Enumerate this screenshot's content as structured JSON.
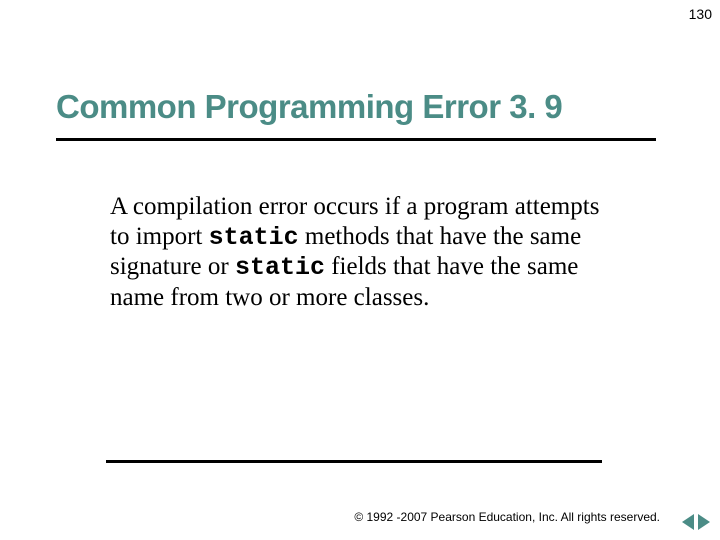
{
  "page_number": "130",
  "title": "Common Programming Error 3. 9",
  "body": {
    "seg1": "A compilation error occurs if a program attempts to import ",
    "code1": "static",
    "seg2": " methods that have the same signature or ",
    "code2": "static",
    "seg3": " fields that have the same name from two or more classes.",
    "full_plain": "A compilation error occurs if a program attempts to import static methods that have the same signature or static fields that have the same name from two or more classes."
  },
  "footer": {
    "copyright_symbol": "©",
    "text": " 1992 -2007 Pearson Education, Inc. All rights reserved."
  },
  "colors": {
    "accent": "#4b8c86"
  }
}
